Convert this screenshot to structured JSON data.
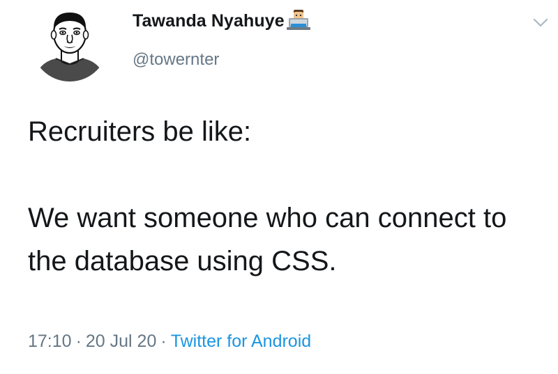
{
  "author": {
    "display_name": "Tawanda Nyahuye",
    "name_emoji": "man-technologist-emoji",
    "handle": "@towernter",
    "avatar": "avatar-cartoon-portrait"
  },
  "tweet": {
    "paragraphs": [
      "Recruiters be like:",
      "We want someone who can connect to the database using CSS."
    ]
  },
  "meta": {
    "time": "17:10",
    "separator": "·",
    "date": "20 Jul 20",
    "source": "Twitter for Android"
  },
  "icons": {
    "menu": "chevron-down-icon"
  },
  "colors": {
    "text": "#14171a",
    "secondary": "#657786",
    "link": "#1b95e0"
  }
}
